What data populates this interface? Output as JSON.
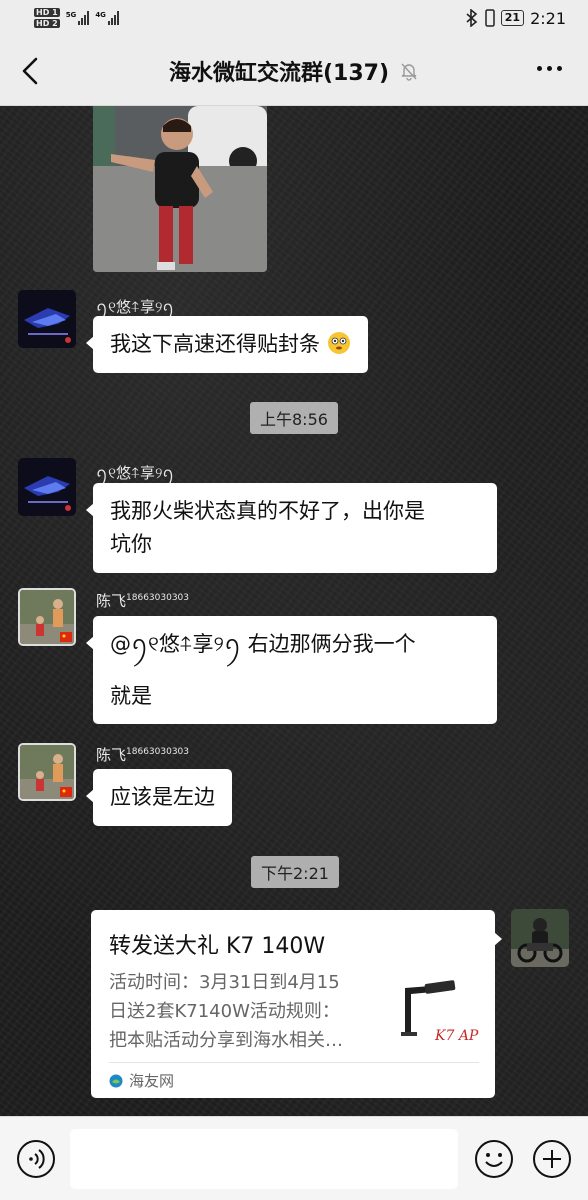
{
  "status_bar": {
    "hd1": "HD 1",
    "hd2": "HD 2",
    "net1": "5G",
    "net2": "4G",
    "battery": "21",
    "time": "2:21"
  },
  "header": {
    "title": "海水微缸交流群(137)"
  },
  "messages": [
    {
      "sender": "ꪆ୧悠⍏享୨ꪆ",
      "text": "我这下高速还得贴封条"
    },
    {
      "time": "上午8:56"
    },
    {
      "sender": "ꪆ୧悠⍏享୨ꪆ",
      "text_line1": "我那火柴状态真的不好了，出你是",
      "text_line2": "坑你"
    },
    {
      "sender_name": "陈飞",
      "sender_tag": "18663030303",
      "text_line1": "@ꪆ୧悠⍏享୨ꪆ 右边那俩分我一个",
      "text_line2": "就是"
    },
    {
      "sender_name": "陈飞",
      "sender_tag": "18663030303",
      "text": "应该是左边"
    },
    {
      "time": "下午2:21"
    }
  ],
  "share_card": {
    "title": "转发送大礼 K7 140W",
    "desc_line1": "活动时间：3月31日到4月15",
    "desc_line2": "日送2套K7140W活动规则：",
    "desc_line3": "把本贴活动分享到海水相关…",
    "source": "海友网",
    "thumb_mark": "K7 AP"
  },
  "input_bar": {
    "placeholder": ""
  },
  "colors": {
    "bar_bg": "#ededed",
    "bubble_bg": "#ffffff",
    "chat_bg": "#1e1e1e",
    "time_pill": "#c8c8c8"
  }
}
